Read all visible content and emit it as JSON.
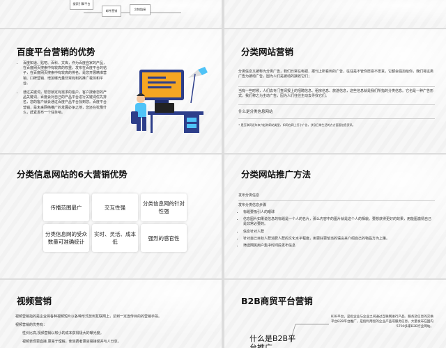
{
  "slide1": {
    "diagram": [
      "搜索引擎平台",
      "邮件营销",
      "文物链接"
    ]
  },
  "slide2": {
    "title": "百度平台营销的优势",
    "bullets": [
      "百度知道、贴吧、百科、文库，作为百度自家的产品，在百度网页搜索中有较高的权重，发布在百度平台的帖子，在百度网页搜索中有较高的排名，是您开展精准营销、口碑营销、增加曝光量非常有利的推广载体和平台。",
      "通过关键词，帮您锁定有需求的客户，客户搜索您的产品关键词，百度会对自己的产品平台进行关键词优先排名，您的客户就会通过百度产品平台找到您。百度平台营销，是未来网络推广的发展必争之地，您还在犹豫什么，赶紧发布一个任务吧。"
    ]
  },
  "slide3": {
    "title": "分类网站营销",
    "p1": "分类信息又被称为分类广告，我们日常在电视、报刊上所看到的广告，往往是不管你愿意不愿意，它都会强加给你，我们将这类广告为被动广告，因为人们是被动的接收它们；",
    "p2": "当有一些时候，人们去专门查阅报上的招聘信息、租房信息、旅游信息，这些信息就是我们所指的分类信息。它也是一种广告形式，我们称之为主动广告，因为人们往往主动去寻找它们。",
    "sub": "什么是分类信息网站",
    "foot": "• 是互联网近年来兴起的网站类型，如同在网上打小广告，涉及日常生活的方方面面信息资讯。"
  },
  "slide4": {
    "title": "分类信息网站的6大营销优势",
    "boxes": [
      "传播范围最广",
      "交互性强",
      "分类信息网的针对性强",
      "分类信息网的受众数量可准确统计",
      "实时、灵活、成本低",
      "强烈的感官性"
    ]
  },
  "slide5": {
    "title": "分类网站推广方法",
    "lead1": "发布分类信息",
    "lead2": "发布分类信息步骤",
    "items": [
      "标题要吸引人的眼球",
      "信息图片如果说信息的标题是一个人的名片，那么内容中的图片就是这个人的相貌。要想获得更好的效果，用能图激情自己是非常必要的。",
      "信息针对人群",
      "针对自己目标人群消费人群的文化水平程度，用更好更恰当的语言来介绍自己的物品方为上策。",
      "筛选网民用户集中时间段发布信息"
    ]
  },
  "slide6": {
    "title": "视频营销",
    "lines": [
      "视频营销指的是企业将各种视频短片以各种形式放到互联网上，达到一定宣传目的的营销手段。",
      "视频营销的优势有：",
      "性价比高,视频营销以较小的成本获得极大的曝光度。",
      "视频表现更直接,更易于理解，使消费者更容易接受并与人分享。"
    ]
  },
  "slide7": {
    "title": "B2B商贸平台营销",
    "desc": "B2B平台，是指企业与企业之间通过互联网进行产品、服务及信息的交换平台B2B平台推广，是指利用您的企业产品或服务信息，大量发布在国内5700多家B2B行业网站。",
    "big": "什么是B2B平台推广"
  }
}
